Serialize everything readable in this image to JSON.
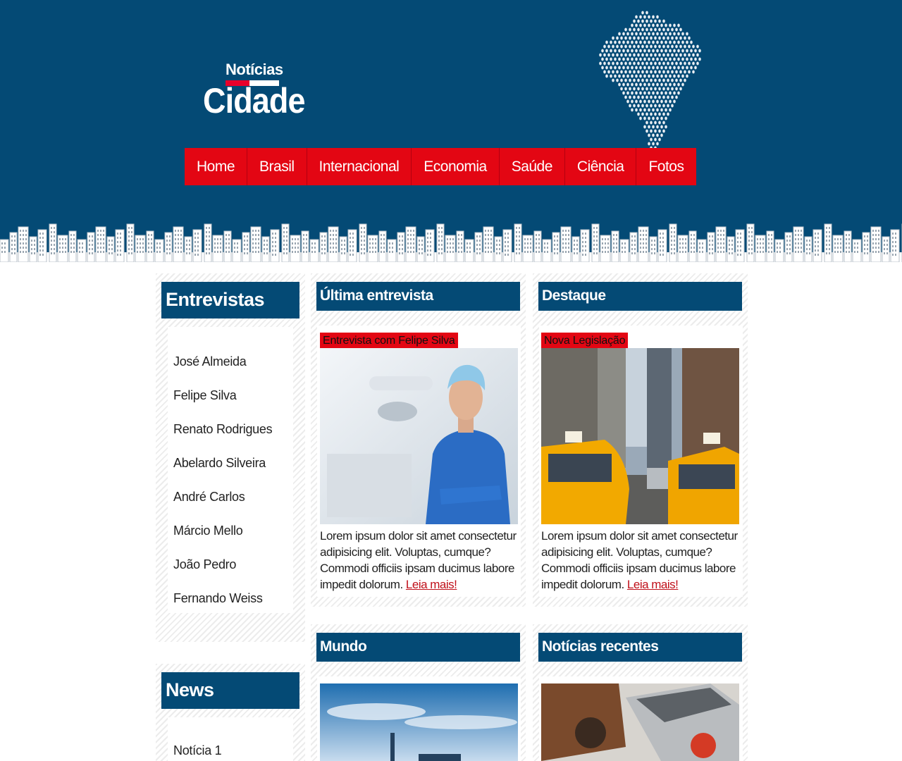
{
  "brand": {
    "top": "Notícias",
    "bottom": "Cidade"
  },
  "nav": [
    "Home",
    "Brasil",
    "Internacional",
    "Economia",
    "Saúde",
    "Ciência",
    "Fotos"
  ],
  "sidebar": {
    "interviews": {
      "title": "Entrevistas",
      "items": [
        "José Almeida",
        "Felipe Silva",
        "Renato Rodrigues",
        "Abelardo Silveira",
        "André Carlos",
        "Márcio Mello",
        "João Pedro",
        "Fernando Weiss"
      ]
    },
    "news": {
      "title": "News",
      "items": [
        "Notícia 1"
      ]
    }
  },
  "cards": {
    "latest": {
      "title": "Última entrevista",
      "tag": "Entrevista com Felipe Silva",
      "text": "Lorem ipsum dolor sit amet consectetur adipisicing elit. Voluptas, cumque? Commodi officiis ipsam ducimus labore impedit dolorum.",
      "link": "Leia mais!"
    },
    "featured": {
      "title": "Destaque",
      "tag": "Nova Legislação",
      "text": "Lorem ipsum dolor sit amet consectetur adipisicing elit. Voluptas, cumque? Commodi officiis ipsam ducimus labore impedit dolorum.",
      "link": "Leia mais!"
    },
    "world": {
      "title": "Mundo"
    },
    "recent": {
      "title": "Notícias recentes"
    }
  },
  "colors": {
    "header": "#044a75",
    "accent": "#e30613",
    "link": "#c0101a"
  }
}
